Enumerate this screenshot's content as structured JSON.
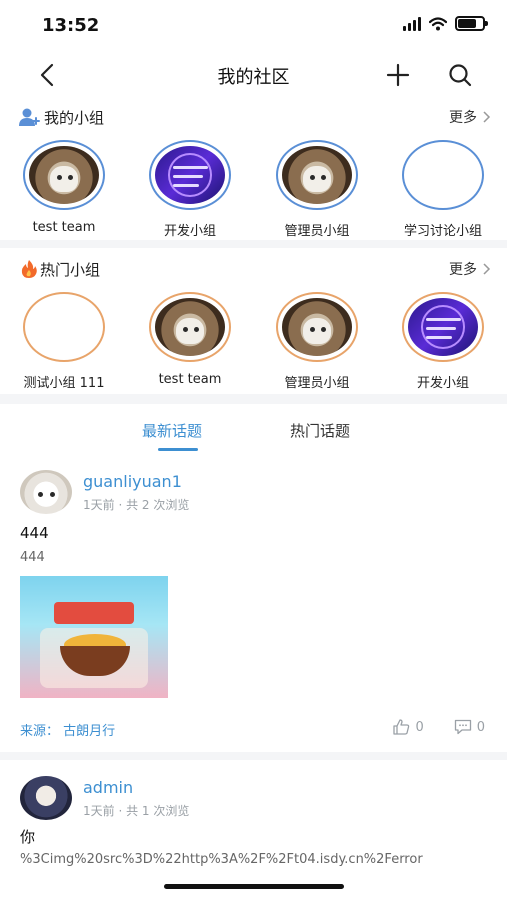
{
  "status_bar": {
    "time": "13:52",
    "battery_level": 0.75
  },
  "header": {
    "title": "我的社区"
  },
  "my_groups": {
    "title": "我的小组",
    "more_label": "更多",
    "items": [
      {
        "name": "test team",
        "image": "cat"
      },
      {
        "name": "开发小组",
        "image": "promo"
      },
      {
        "name": "管理员小组",
        "image": "cat"
      },
      {
        "name": "学习讨论小组",
        "image": "empty"
      }
    ]
  },
  "hot_groups": {
    "title": "热门小组",
    "more_label": "更多",
    "items": [
      {
        "name": "测试小组 111",
        "image": "empty"
      },
      {
        "name": "test team",
        "image": "cat"
      },
      {
        "name": "管理员小组",
        "image": "cat"
      },
      {
        "name": "开发小组",
        "image": "promo"
      }
    ]
  },
  "tabs": {
    "latest": "最新话题",
    "hot": "热门话题",
    "active": "latest"
  },
  "posts": [
    {
      "username": "guanliyuan1",
      "meta": "1天前 · 共 2 次浏览",
      "title": "444",
      "body": "444",
      "source": "来源：  古朗月行",
      "likes": "0",
      "comments": "0"
    },
    {
      "username": "admin",
      "meta": "1天前 · 共 1 次浏览",
      "title": "你",
      "body": "%3Cimg%20src%3D%22http%3A%2F%2Ft04.isdy.cn%2Ferror"
    }
  ]
}
